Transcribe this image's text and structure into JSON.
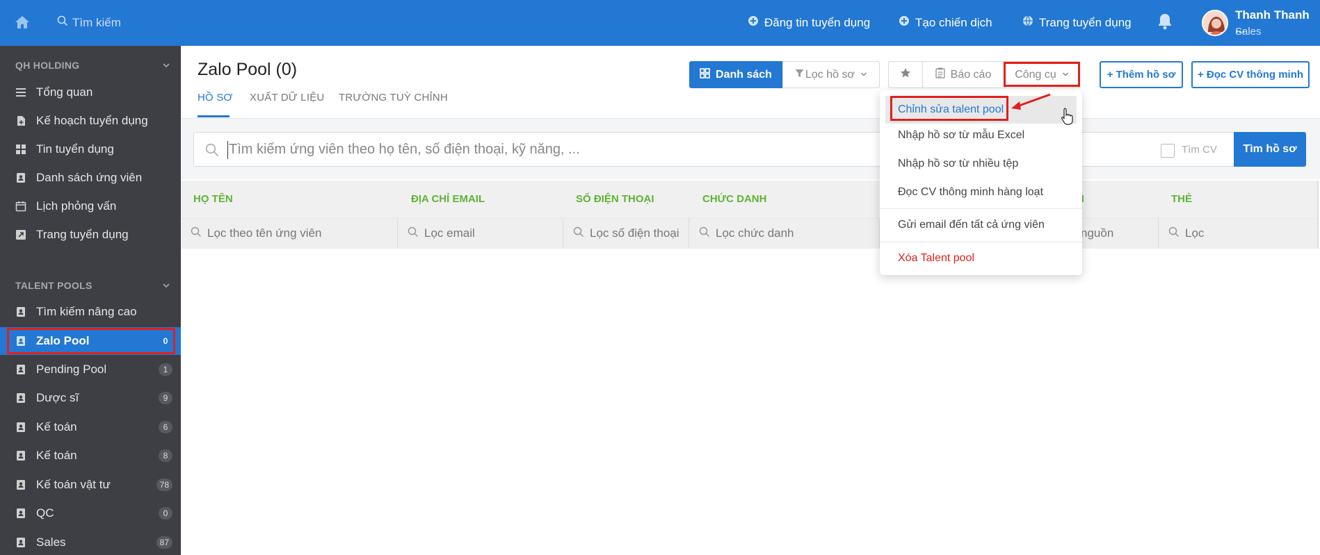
{
  "topbar": {
    "search_placeholder": "Tìm kiếm",
    "nav": [
      "Đăng tin tuyển dụng",
      "Tạo chiến dịch",
      "Trang tuyển dụng"
    ],
    "user_name": "Thanh Thanh ...",
    "user_role": "Sales"
  },
  "sidebar": {
    "org_section": "QH HOLDING",
    "org_items": [
      "Tổng quan",
      "Kế hoạch tuyển dụng",
      "Tin tuyển dụng",
      "Danh sách ứng viên",
      "Lịch phỏng vấn",
      "Trang tuyển dụng"
    ],
    "pools_section": "TALENT POOLS",
    "advanced_search": "Tìm kiếm nâng cao",
    "pools": [
      {
        "name": "Zalo Pool",
        "count": "0"
      },
      {
        "name": "Pending Pool",
        "count": "1"
      },
      {
        "name": "Dược sĩ",
        "count": "9"
      },
      {
        "name": "Kế toán",
        "count": "6"
      },
      {
        "name": "Kế toán",
        "count": "8"
      },
      {
        "name": "Kế toán vật tư",
        "count": "78"
      },
      {
        "name": "QC",
        "count": "0"
      },
      {
        "name": "Sales",
        "count": "87"
      }
    ]
  },
  "page": {
    "title": "Zalo Pool (0)",
    "tabs": [
      "HỒ SƠ",
      "XUẤT DỮ LIỆU",
      "TRƯỜNG TUỲ CHỈNH"
    ]
  },
  "toolbar": {
    "list_label": "Danh sách",
    "filter_label": "Lọc hồ sơ",
    "report_label": "Báo cáo",
    "tools_label": "Công cụ",
    "add_profile": "+ Thêm hồ sơ",
    "smart_cv": "+ Đọc CV thông minh"
  },
  "search": {
    "placeholder": "Tìm kiếm ứng viên theo họ tên, số điện thoại, kỹ năng, ...",
    "cv_checkbox": "Tìm CV",
    "button": "Tìm hồ sơ"
  },
  "table": {
    "headers": [
      "HỌ TÊN",
      "ĐỊA CHỈ EMAIL",
      "SỐ ĐIỆN THOẠI",
      "CHỨC DANH",
      "N",
      "THẺ"
    ],
    "filters": [
      "Lọc theo tên ứng viên",
      "Lọc email",
      "Lọc số điện thoại",
      "Lọc chức danh",
      "nguồn",
      "Lọc"
    ]
  },
  "dropdown": {
    "items": [
      "Chỉnh sửa talent pool",
      "Nhập hồ sơ từ mẫu Excel",
      "Nhập hồ sơ từ nhiều tệp",
      "Đọc CV thông minh hàng loạt",
      "Gửi email đến tất cả ứng viên",
      "Xóa Talent pool"
    ]
  },
  "colors": {
    "primary": "#2378d3",
    "sidebar": "#3d3f44",
    "header_green": "#5fb336",
    "danger": "#d9231c",
    "annotation": "#e0201c"
  }
}
